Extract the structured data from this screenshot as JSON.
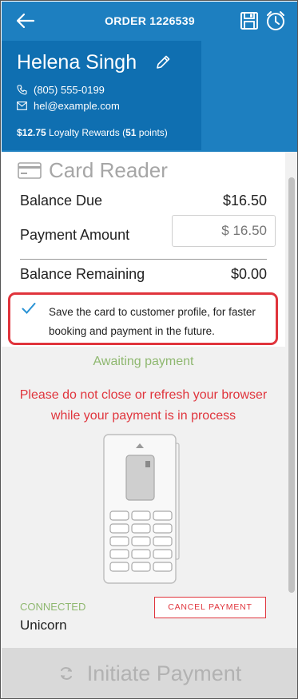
{
  "header": {
    "title": "ORDER 1226539",
    "icons": [
      "back-arrow-icon",
      "save-icon",
      "timer-icon"
    ]
  },
  "customer": {
    "name": "Helena Singh",
    "phone": "(805) 555-0199",
    "email": "hel@example.com",
    "loyalty_amount": "$12.75",
    "loyalty_label": " Loyalty Rewards (",
    "loyalty_points": "51",
    "loyalty_suffix": " points)"
  },
  "card_reader": {
    "title": "Card Reader",
    "balance_due_label": "Balance Due",
    "balance_due_value": "$16.50",
    "payment_amount_label": "Payment Amount",
    "payment_amount_placeholder": "$ 16.50",
    "balance_remaining_label": "Balance Remaining",
    "balance_remaining_value": "$0.00",
    "save_card_text": "Save the card to customer profile, for faster booking and payment in the future.",
    "save_card_checked": true
  },
  "status": {
    "awaiting": "Awaiting payment",
    "warning_line1": "Please do not close or refresh your browser",
    "warning_line2": "while your payment is in process",
    "connected_label": "CONNECTED",
    "device_name": "Unicorn",
    "cancel_label": "CANCEL PAYMENT"
  },
  "footer": {
    "initiate_label": "Initiate Payment"
  },
  "colors": {
    "primary": "#1d7fc0",
    "primary_dark": "#0f6fb1",
    "success": "#8fb870",
    "danger": "#e0343c",
    "disabled": "#b2b2b2"
  }
}
